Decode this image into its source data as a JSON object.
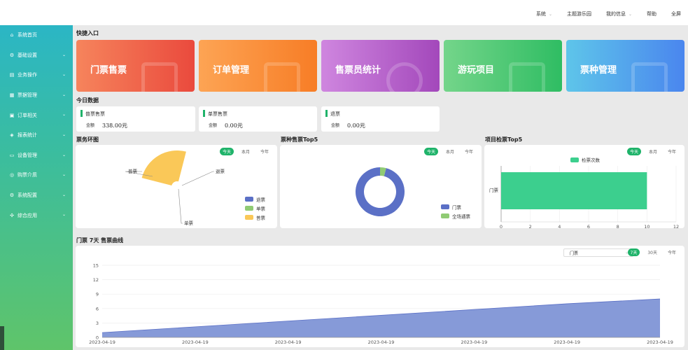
{
  "topnav": {
    "items": [
      {
        "label": "系统",
        "dropdown": true
      },
      {
        "label": "主题游乐园",
        "dropdown": false
      },
      {
        "label": "我的信息",
        "dropdown": true
      },
      {
        "label": "帮助",
        "dropdown": false
      },
      {
        "label": "全屏",
        "dropdown": false
      }
    ]
  },
  "sidebar": {
    "items": [
      {
        "label": "系统首页",
        "icon": "home-icon",
        "arrow": false
      },
      {
        "label": "基础设置",
        "icon": "gear-icon",
        "arrow": true
      },
      {
        "label": "业务操作",
        "icon": "document-icon",
        "arrow": true
      },
      {
        "label": "票据管理",
        "icon": "ticket-icon",
        "arrow": true
      },
      {
        "label": "订单相关",
        "icon": "order-icon",
        "arrow": true
      },
      {
        "label": "报表统计",
        "icon": "chart-icon",
        "arrow": true
      },
      {
        "label": "设备管理",
        "icon": "monitor-icon",
        "arrow": true
      },
      {
        "label": "购票介质",
        "icon": "card-icon",
        "arrow": true
      },
      {
        "label": "系统配置",
        "icon": "settings-icon",
        "arrow": true
      },
      {
        "label": "综合应用",
        "icon": "apps-icon",
        "arrow": true
      }
    ]
  },
  "quick": {
    "title": "快捷入口",
    "cards": [
      {
        "label": "门票售票",
        "from": "#f6845c",
        "to": "#ea4a3d"
      },
      {
        "label": "订单管理",
        "from": "#fda454",
        "to": "#f77d26"
      },
      {
        "label": "售票员统计",
        "from": "#cf86df",
        "to": "#a348bb"
      },
      {
        "label": "游玩项目",
        "from": "#74d58a",
        "to": "#2fbd63"
      },
      {
        "label": "票种管理",
        "from": "#5ec5ea",
        "to": "#4a86ee"
      }
    ]
  },
  "today": {
    "title": "今日数据",
    "cards": [
      {
        "title": "普票售票",
        "key": "金额",
        "value": "338.00元"
      },
      {
        "title": "单票售票",
        "key": "金额",
        "value": "0.00元"
      },
      {
        "title": "退票",
        "key": "金额",
        "value": "0.00元"
      }
    ]
  },
  "periods": {
    "today": "今天",
    "month": "本月",
    "year": "今年",
    "week": "7天",
    "days30": "30天"
  },
  "panels": {
    "ring_title": "票务环图",
    "type_title": "票种售票Top5",
    "project_title": "项目检票Top5",
    "curve_title": "门票 7天 售票曲线",
    "select_value": "门票"
  },
  "colors": {
    "green": "#1fb36a",
    "blue": "#5b70c6",
    "lightgreen": "#90cb74",
    "yellow": "#fac858",
    "teal": "#3ccf8e",
    "area": "#7f95d6"
  },
  "chart_data": [
    {
      "type": "pie",
      "title": "票务环图",
      "categories": [
        "退票",
        "单票",
        "普票"
      ],
      "values": [
        0,
        0,
        338
      ],
      "colors": [
        "#5b70c6",
        "#90cb74",
        "#fac858"
      ],
      "legend": "right-bottom"
    },
    {
      "type": "pie",
      "title": "票种售票Top5",
      "categories": [
        "门票",
        "全场通票"
      ],
      "values": [
        96,
        4
      ],
      "colors": [
        "#5b70c6",
        "#90cb74"
      ],
      "legend": "right-bottom"
    },
    {
      "type": "bar",
      "title": "项目检票Top5",
      "orientation": "horizontal",
      "categories": [
        "门票"
      ],
      "series": [
        {
          "name": "检票次数",
          "values": [
            10
          ]
        }
      ],
      "xticks": [
        "0",
        "2",
        "4",
        "6",
        "8",
        "10",
        "12"
      ],
      "xlim": [
        0,
        12
      ],
      "color": "#3ccf8e"
    },
    {
      "type": "area",
      "title": "门票 7天 售票曲线",
      "x": [
        "2023-04-19",
        "2023-04-19",
        "2023-04-19",
        "2023-04-19",
        "2023-04-19",
        "2023-04-19",
        "2023-04-19"
      ],
      "values": [
        1,
        2.2,
        3.4,
        4.6,
        5.8,
        7,
        8
      ],
      "yticks": [
        "0",
        "3",
        "6",
        "9",
        "12",
        "15"
      ],
      "ylim": [
        0,
        15
      ],
      "color": "#7f95d6"
    }
  ]
}
